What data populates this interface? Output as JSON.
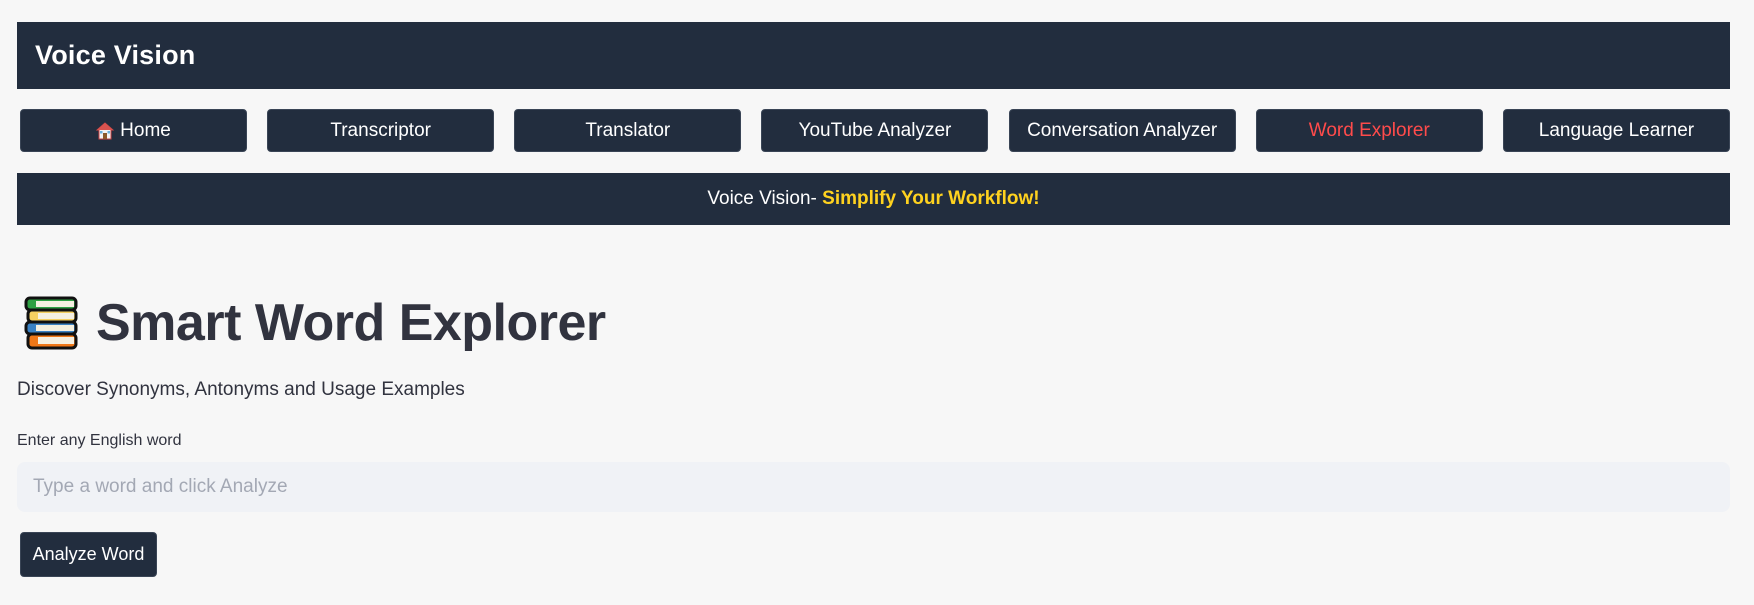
{
  "app": {
    "title": "Voice Vision"
  },
  "nav": {
    "items": [
      {
        "label": "Home",
        "icon": "house-icon",
        "active": false
      },
      {
        "label": "Transcriptor",
        "active": false
      },
      {
        "label": "Translator",
        "active": false
      },
      {
        "label": "YouTube Analyzer",
        "active": false
      },
      {
        "label": "Conversation Analyzer",
        "active": false
      },
      {
        "label": "Word Explorer",
        "active": true
      },
      {
        "label": "Language Learner",
        "active": false
      }
    ]
  },
  "banner": {
    "prefix": "Voice Vision- ",
    "highlight": "Simplify Your Workflow!"
  },
  "main": {
    "title_icon": "books-icon",
    "title": "Smart Word Explorer",
    "subtitle": "Discover Synonyms, Antonyms and Usage Examples",
    "input_label": "Enter any English word",
    "input_value": "",
    "input_placeholder": "Type a word and click Analyze",
    "button_label": "Analyze Word"
  },
  "colors": {
    "dark_navy": "#222d3e",
    "active_red": "#ff4b4b",
    "highlight_yellow": "#ffd21f",
    "background": "#f7f7f7",
    "input_bg": "#f0f2f6"
  }
}
